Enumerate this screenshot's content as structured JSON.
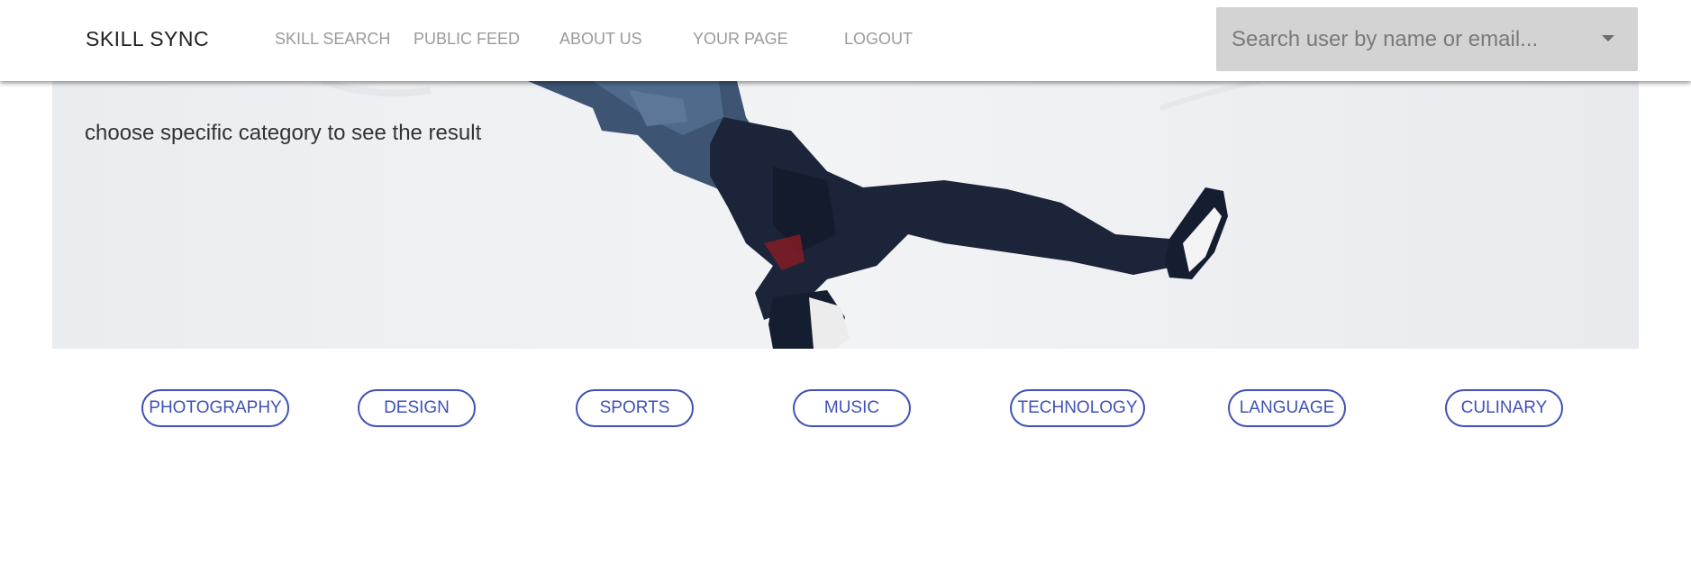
{
  "brand": "SKILL SYNC",
  "nav": {
    "skill_search": "SKILL SEARCH",
    "public_feed": "PUBLIC FEED",
    "about_us": "ABOUT US",
    "your_page": "YOUR PAGE",
    "logout": "LOGOUT"
  },
  "search": {
    "placeholder": "Search user by name or email...",
    "value": "",
    "icon": "chevron-down-icon"
  },
  "hero": {
    "text": "choose specific category to see the result",
    "image": "person-jumping-photo"
  },
  "categories": [
    "PHOTOGRAPHY",
    "DESIGN",
    "SPORTS",
    "MUSIC",
    "TECHNOLOGY",
    "LANGUAGE",
    "CULINARY"
  ],
  "colors": {
    "accent": "#3f51b5",
    "nav_text": "#9a9a9a",
    "search_bg": "#d3d3d3"
  }
}
